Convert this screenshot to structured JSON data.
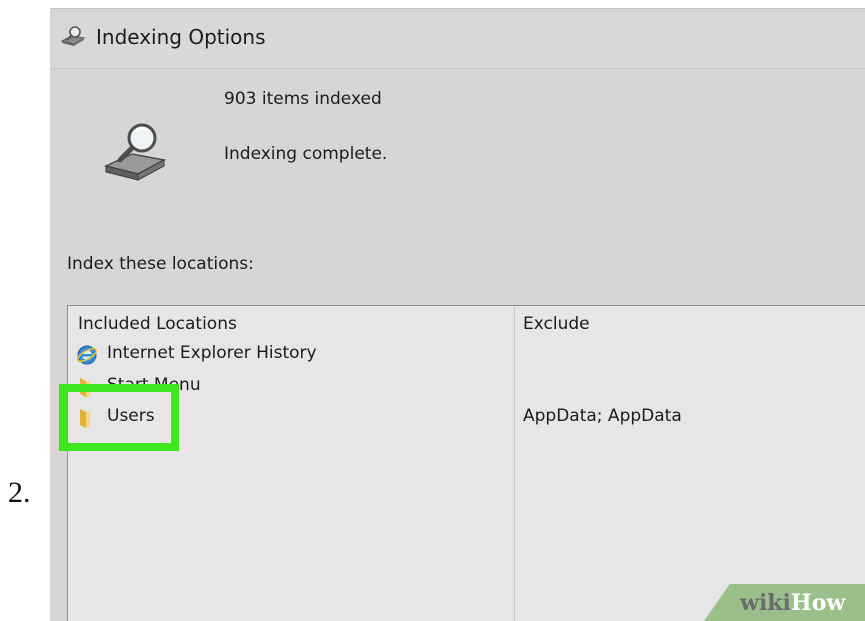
{
  "step_number": "2.",
  "window": {
    "title": "Indexing Options",
    "status": {
      "items_indexed": "903 items indexed",
      "message": "Indexing complete."
    },
    "locations_label": "Index these locations:",
    "locations_table": {
      "columns": [
        "Included Locations",
        "Exclude"
      ],
      "rows": [
        {
          "name": "Internet Explorer History",
          "exclude": "",
          "icon": "internet-explorer-icon"
        },
        {
          "name": "Start Menu",
          "exclude": "",
          "icon": "folder-icon"
        },
        {
          "name": "Users",
          "exclude": "AppData; AppData",
          "icon": "folder-icon"
        }
      ]
    }
  },
  "highlight_color": "#3ee61d",
  "watermark": {
    "part1": "wiki",
    "part2": "How"
  }
}
